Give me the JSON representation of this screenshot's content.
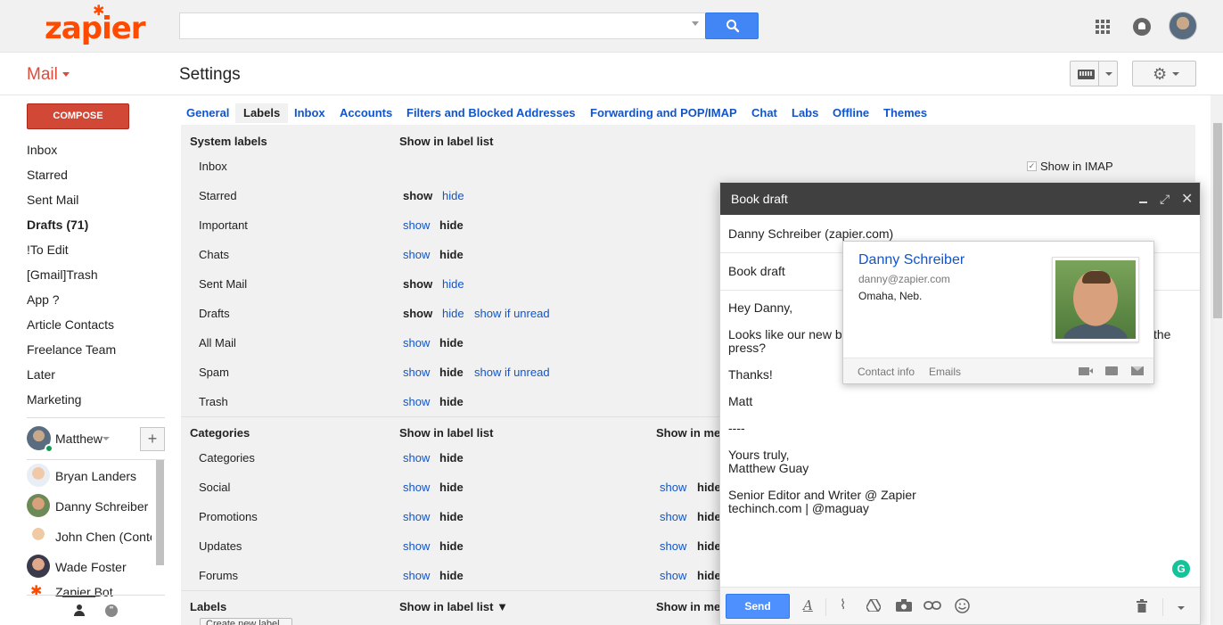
{
  "brand": {
    "logo_text": "zapier",
    "logo_star": "✱"
  },
  "search": {
    "placeholder": "",
    "value": ""
  },
  "header": {
    "mail_label": "Mail",
    "page_title": "Settings"
  },
  "nav": {
    "compose_label": "COMPOSE",
    "items": [
      {
        "label": "Inbox",
        "bold": false
      },
      {
        "label": "Starred",
        "bold": false
      },
      {
        "label": "Sent Mail",
        "bold": false
      },
      {
        "label": "Drafts (71)",
        "bold": true
      },
      {
        "label": "!To Edit",
        "bold": false
      },
      {
        "label": "[Gmail]Trash",
        "bold": false
      },
      {
        "label": "App ?",
        "bold": false
      },
      {
        "label": "Article Contacts",
        "bold": false
      },
      {
        "label": "Freelance Team",
        "bold": false
      },
      {
        "label": "Later",
        "bold": false
      },
      {
        "label": "Marketing",
        "bold": false
      }
    ]
  },
  "chat": {
    "me_name": "Matthew",
    "add_label": "+",
    "contacts": [
      {
        "name": "Bryan Landers"
      },
      {
        "name": "Danny Schreiber"
      },
      {
        "name": "John Chen (Content Marketing)"
      },
      {
        "name": "Wade Foster"
      },
      {
        "name": "Zapier Bot"
      }
    ],
    "hangouts_glyph": "\""
  },
  "tabs": [
    {
      "label": "General"
    },
    {
      "label": "Labels"
    },
    {
      "label": "Inbox"
    },
    {
      "label": "Accounts"
    },
    {
      "label": "Filters and Blocked Addresses"
    },
    {
      "label": "Forwarding and POP/IMAP"
    },
    {
      "label": "Chat"
    },
    {
      "label": "Labs"
    },
    {
      "label": "Offline"
    },
    {
      "label": "Themes"
    }
  ],
  "labels_settings": {
    "system_header": "System labels",
    "show_in_label_list": "Show in label list",
    "show_in_imap": "Show in IMAP",
    "show": "show",
    "hide": "hide",
    "show_if_unread": "show if unread",
    "system_rows": [
      {
        "label": "Inbox"
      },
      {
        "label": "Starred"
      },
      {
        "label": "Important"
      },
      {
        "label": "Chats"
      },
      {
        "label": "Sent Mail"
      },
      {
        "label": "Drafts"
      },
      {
        "label": "All Mail"
      },
      {
        "label": "Spam"
      },
      {
        "label": "Trash"
      }
    ],
    "categories_header": "Categories",
    "show_in_message_list": "Show in me",
    "category_rows": [
      {
        "label": "Categories"
      },
      {
        "label": "Social"
      },
      {
        "label": "Promotions"
      },
      {
        "label": "Updates"
      },
      {
        "label": "Forums"
      }
    ],
    "labels_header": "Labels",
    "labels_list_header": "Show in label list ▼",
    "create_label": "Create new label"
  },
  "compose": {
    "title": "Book draft",
    "to": "Danny Schreiber (zapier.com)",
    "subject": "Book draft",
    "body_lines": [
      "Hey Danny,",
      "Looks like our new boo",
      "the",
      "press?",
      "Thanks!",
      "Matt",
      "----",
      "Yours truly,",
      "Matthew Guay",
      "Senior Editor and Writer @ Zapier",
      "techinch.com | @maguay"
    ],
    "send_label": "Send",
    "grammarly_glyph": "G"
  },
  "hover_card": {
    "name": "Danny Schreiber",
    "email": "danny@zapier.com",
    "location": "Omaha, Neb.",
    "contact_info": "Contact info",
    "emails": "Emails"
  },
  "colors": {
    "brand": "#ff4a00",
    "compose_red": "#d14836",
    "link_blue": "#1155cc",
    "send_blue": "#4d90fe",
    "grammarly": "#15c39a"
  }
}
